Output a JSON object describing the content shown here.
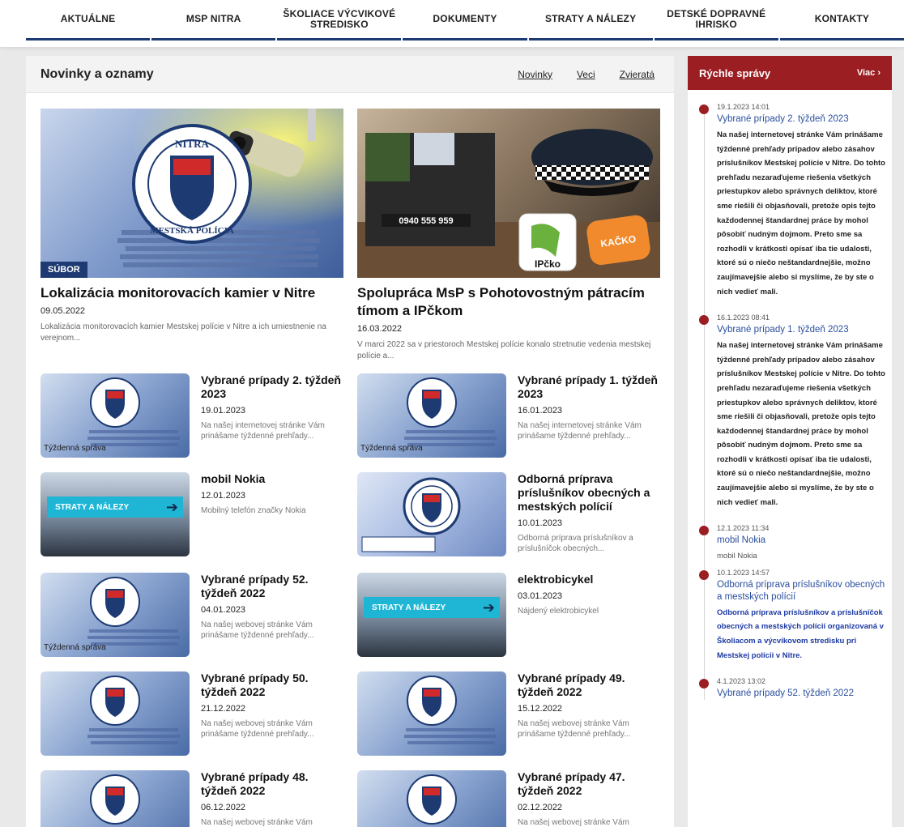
{
  "nav": {
    "items": [
      "AKTUÁLNE",
      "MSP NITRA",
      "ŠKOLIACE VÝCVIKOVÉ STREDISKO",
      "DOKUMENTY",
      "STRATY A NÁLEZY",
      "DETSKÉ DOPRAVNÉ IHRISKO",
      "KONTAKTY"
    ]
  },
  "main": {
    "title": "Novinky a oznamy",
    "filters": [
      "Novinky",
      "Veci",
      "Zvieratá"
    ],
    "featured": [
      {
        "badge": "SÚBOR",
        "title": "Lokalizácia monitorovacích kamier v Nitre",
        "date": "09.05.2022",
        "desc": "Lokalizácia monitorovacích kamier Mestskej polície v Nitre a ich umiestnenie na verejnom..."
      },
      {
        "badge": "",
        "title": "Spolupráca MsP s Pohotovostným pátracím tímom a IPčkom",
        "date": "16.03.2022",
        "desc": "V marci 2022 sa v priestoroch Mestskej polície konalo stretnutie vedenia mestskej polície a..."
      }
    ],
    "cards": [
      {
        "title": "Vybrané prípady 2. týždeň 2023",
        "date": "19.01.2023",
        "desc": "Na našej internetovej stránke Vám prinášame týždenné prehľady...",
        "thumb_label": "Týždenná správa"
      },
      {
        "title": "Vybrané prípady 1. týždeň 2023",
        "date": "16.01.2023",
        "desc": "Na našej internetovej stránke Vám prinášame týždenné prehľady...",
        "thumb_label": "Týždenná správa"
      },
      {
        "title": "mobil Nokia",
        "date": "12.01.2023",
        "desc": "Mobilný telefón značky Nokia",
        "thumb_label": "STRATY A NÁLEZY"
      },
      {
        "title": "Odborná príprava príslušníkov obecných a mestských polícií",
        "date": "10.01.2023",
        "desc": "Odborná príprava príslušníkov a príslušníčok obecných...",
        "thumb_label": ""
      },
      {
        "title": "Vybrané prípady 52. týždeň 2022",
        "date": "04.01.2023",
        "desc": "Na našej webovej stránke Vám prinášame týždenné prehľady...",
        "thumb_label": "Týždenná správa"
      },
      {
        "title": "elektrobicykel",
        "date": "03.01.2023",
        "desc": "Nájdený elektrobicykel",
        "thumb_label": "STRATY A NÁLEZY"
      },
      {
        "title": "Vybrané prípady 50. týždeň 2022",
        "date": "21.12.2022",
        "desc": "Na našej webovej stránke Vám prinášame týždenné prehľady...",
        "thumb_label": ""
      },
      {
        "title": "Vybrané prípady 49. týždeň 2022",
        "date": "15.12.2022",
        "desc": "Na našej webovej stránke Vám prinášame týždenné prehľady...",
        "thumb_label": ""
      },
      {
        "title": "Vybrané prípady 48. týždeň 2022",
        "date": "06.12.2022",
        "desc": "Na našej webovej stránke Vám",
        "thumb_label": ""
      },
      {
        "title": "Vybrané prípady 47. týždeň 2022",
        "date": "02.12.2022",
        "desc": "Na našej webovej stránke Vám",
        "thumb_label": ""
      }
    ]
  },
  "sidebar": {
    "title": "Rýchle správy",
    "more": "Viac ›",
    "items": [
      {
        "time": "19.1.2023 14:01",
        "title": "Vybrané prípady 2. týždeň 2023",
        "text": "Na našej internetovej stránke Vám prinášame týždenné prehľady prípadov alebo zásahov príslušníkov Mestskej polície v Nitre. Do tohto prehľadu nezaraďujeme riešenia všetkých priestupkov alebo správnych deliktov, ktoré sme riešili či objasňovali, pretože opis tejto každodennej štandardnej práce by mohol pôsobiť nudným dojmom. Preto sme sa rozhodli v krátkosti opísať iba tie udalosti, ktoré sú o niečo neštandardnejšie, možno zaujímavejšie alebo si myslíme, že by ste o nich vedieť mali.",
        "style": "bold"
      },
      {
        "time": "16.1.2023 08:41",
        "title": "Vybrané prípady 1. týždeň 2023",
        "text": "Na našej internetovej stránke Vám prinášame týždenné prehľady prípadov alebo zásahov príslušníkov Mestskej polície v Nitre. Do tohto prehľadu nezaraďujeme riešenia všetkých priestupkov alebo správnych deliktov, ktoré sme riešili či objasňovali, pretože opis tejto každodennej štandardnej práce by mohol pôsobiť nudným dojmom. Preto sme sa rozhodli v krátkosti opísať iba tie udalosti, ktoré sú o niečo neštandardnejšie, možno zaujímavejšie alebo si myslíme, že by ste o nich vedieť mali.",
        "style": "bold"
      },
      {
        "time": "12.1.2023 11:34",
        "title": "mobil Nokia",
        "text": "mobil Nokia",
        "style": "plain"
      },
      {
        "time": "10.1.2023 14:57",
        "title": "Odborná príprava príslušníkov obecných a mestských polícií",
        "text": "Odborná príprava príslušníkov a príslušníčok obecných a mestských polícií organizovaná v Školiacom a výcvikovom stredisku pri Mestskej polícii v Nitre.",
        "style": "link"
      },
      {
        "time": "4.1.2023 13:02",
        "title": "Vybrané prípady 52. týždeň 2022",
        "text": "",
        "style": "bold"
      }
    ]
  },
  "colors": {
    "nav_underline": "#1d3a73",
    "sidebar_header": "#9b1e22",
    "link_blue": "#2a4f9e",
    "badge_bg": "#1d3a73"
  },
  "emblem": {
    "top_text": "NITRA",
    "bottom_text": "MESTSKÁ POLÍCIA"
  },
  "promo": {
    "phone": "0940 555 959",
    "ipcko": "IPčko",
    "kacko": "KAČKO"
  }
}
